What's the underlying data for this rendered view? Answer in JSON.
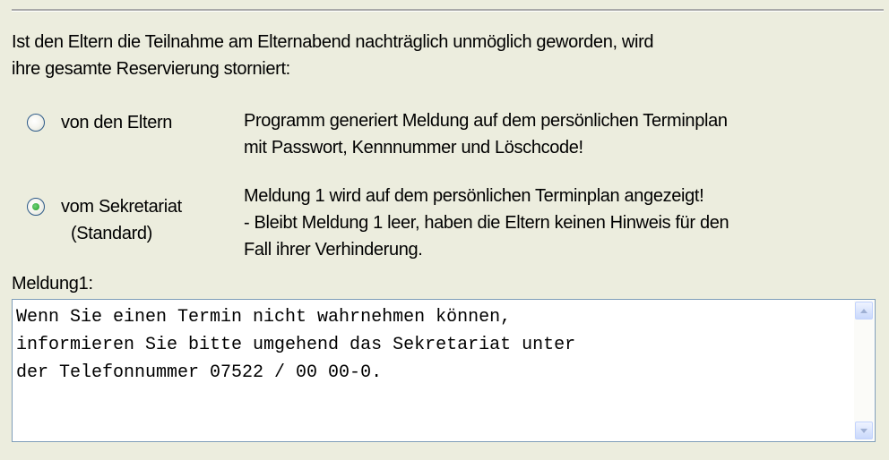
{
  "intro": {
    "line1": "Ist den Eltern die Teilnahme am Elternabend nachträglich unmöglich geworden, wird",
    "line2": "ihre gesamte Reservierung storniert:"
  },
  "options": [
    {
      "label": "von den Eltern",
      "label2": "",
      "selected": false,
      "desc_line1": "Programm generiert Meldung auf dem persönlichen Terminplan",
      "desc_line2": "mit Passwort, Kennnummer und Löschcode!",
      "desc_line3": ""
    },
    {
      "label": "vom Sekretariat",
      "label2": "(Standard)",
      "selected": true,
      "desc_line1": "Meldung 1 wird auf dem persönlichen Terminplan angezeigt!",
      "desc_line2": "- Bleibt Meldung 1 leer, haben die Eltern keinen Hinweis für den",
      "desc_line3": "Fall ihrer Verhinderung."
    }
  ],
  "message_field": {
    "label": "Meldung1:",
    "value": "Wenn Sie einen Termin nicht wahrnehmen können,\ninformieren Sie bitte umgehend das Sekretariat unter\nder Telefonnummer 07522 / 00 00-0."
  }
}
